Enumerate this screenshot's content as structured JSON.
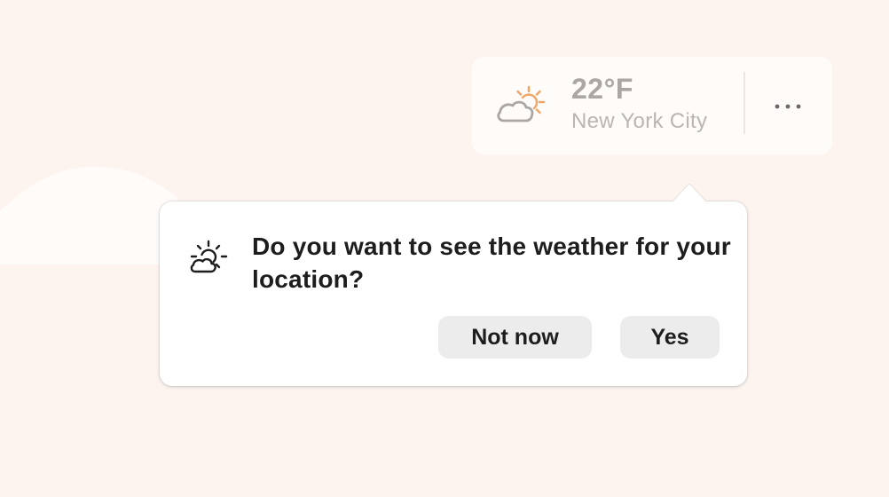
{
  "weather_card": {
    "temperature": "22°F",
    "city": "New York City",
    "condition_icon": "partly-cloudy-icon",
    "more_icon": "more-horizontal-icon"
  },
  "location_prompt": {
    "icon": "partly-sunny-icon",
    "question": "Do you want to see the weather for your location?",
    "decline_label": "Not now",
    "accept_label": "Yes"
  },
  "colors": {
    "background": "#fdf4ef",
    "sun_accent": "#f0a766",
    "muted_text": "#a9a6a4",
    "button_bg": "#ececec"
  }
}
